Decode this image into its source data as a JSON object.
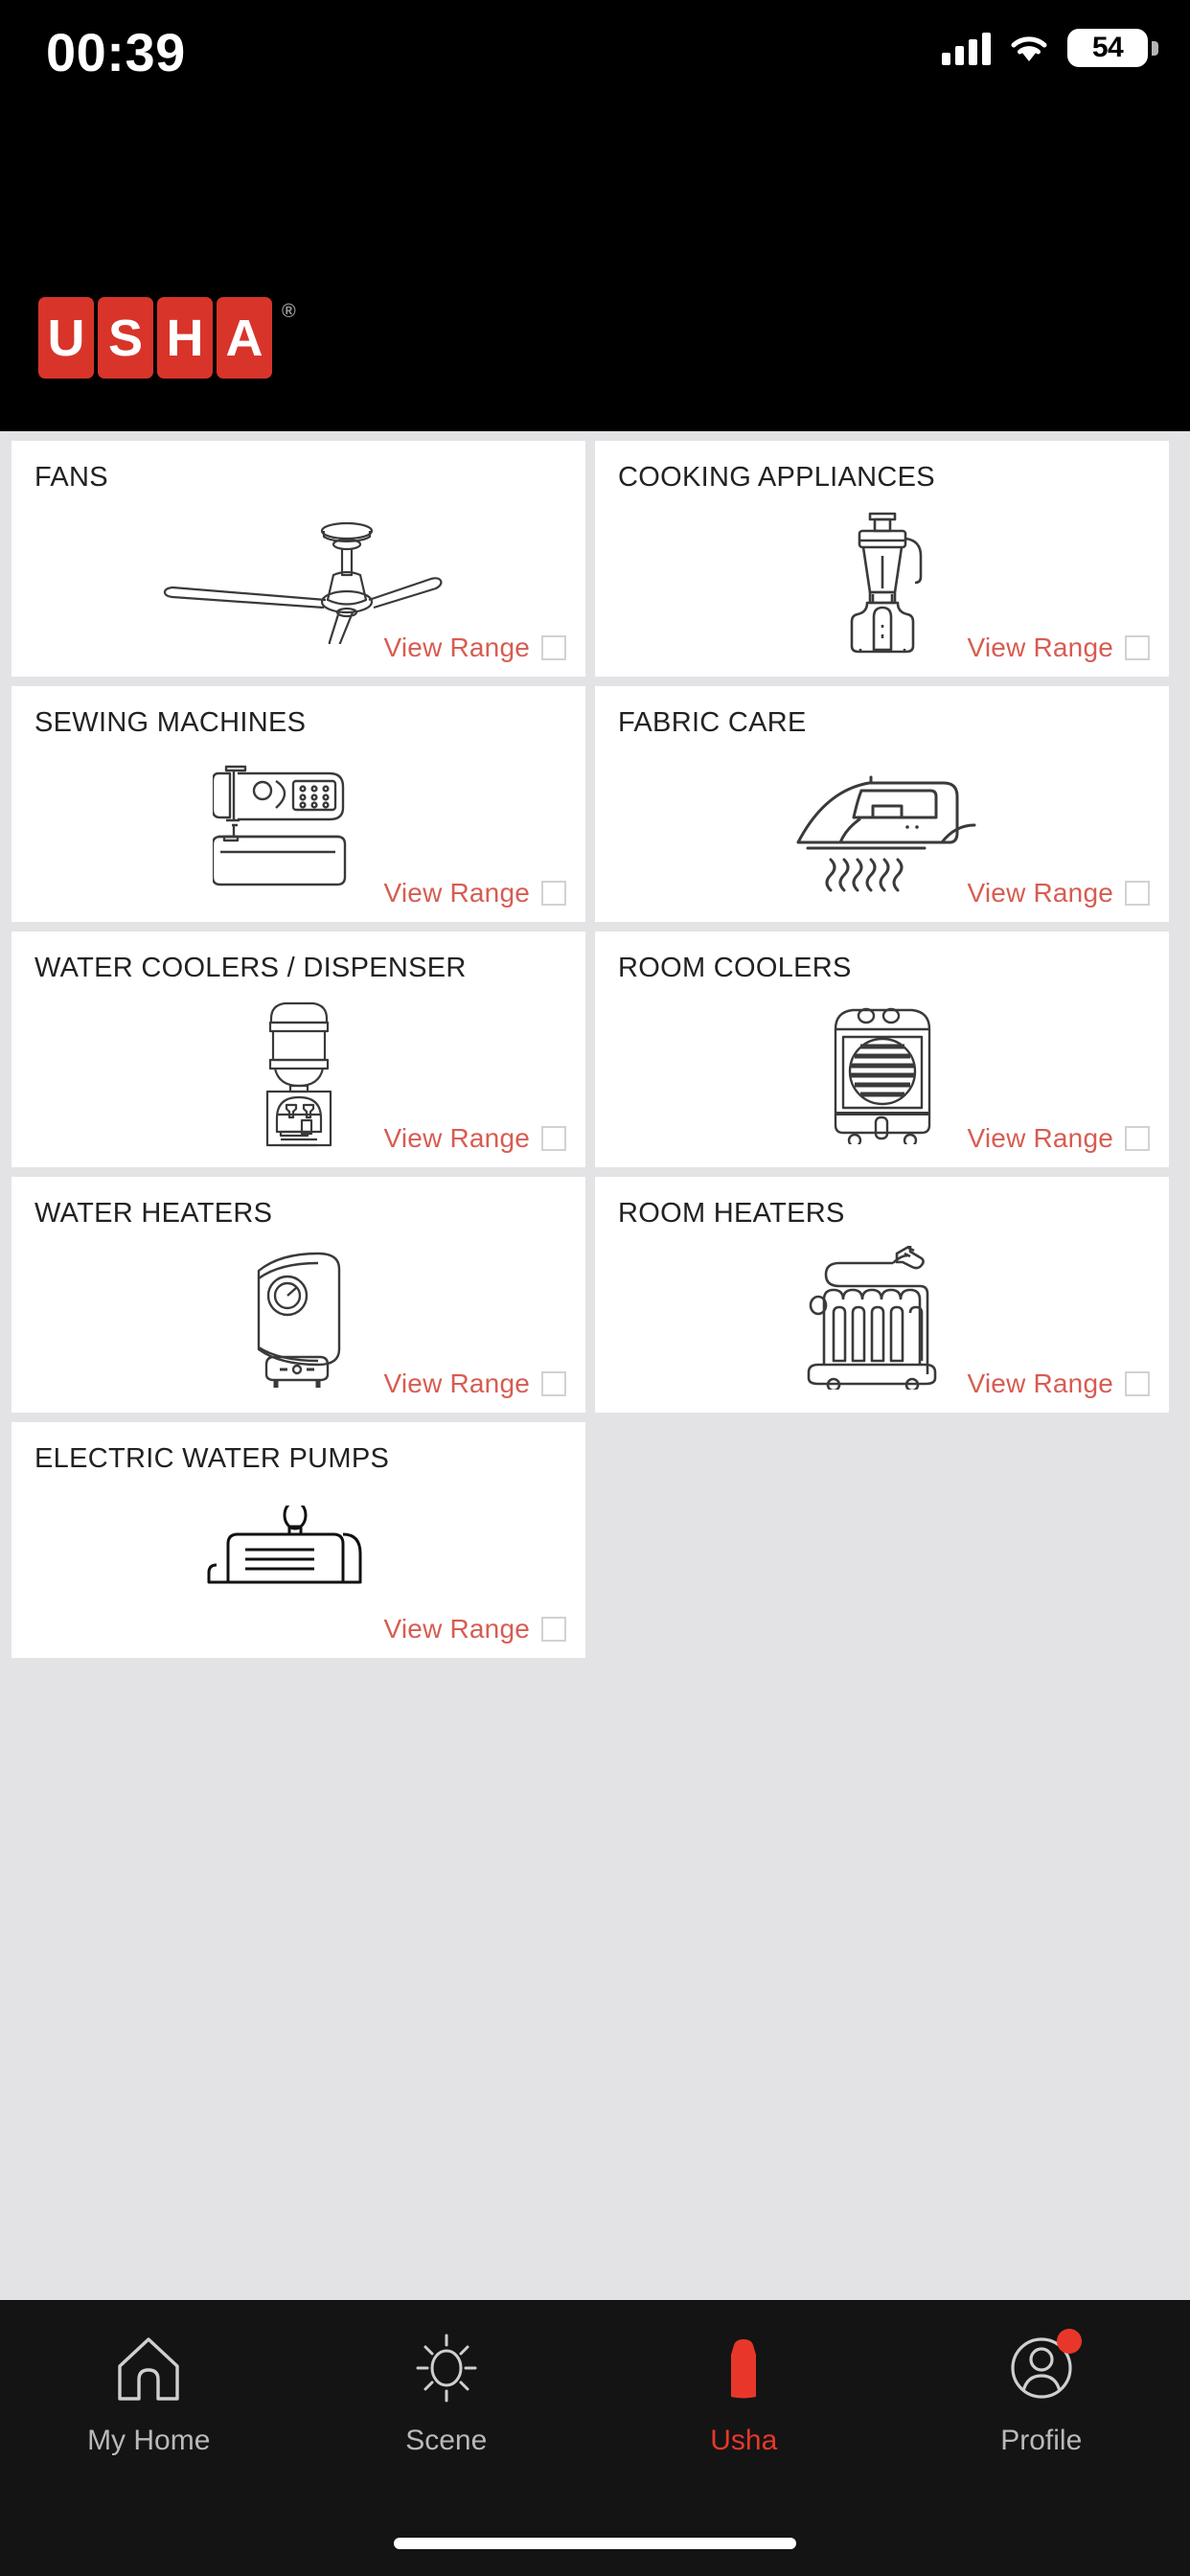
{
  "status_bar": {
    "time": "00:39",
    "battery_percent": "54",
    "icons": [
      "cellular-signal-icon",
      "wifi-icon",
      "battery-icon"
    ]
  },
  "header": {
    "brand": "USHA",
    "brand_letters": [
      "U",
      "S",
      "H",
      "A"
    ],
    "registered_mark": "®",
    "brand_color": "#d8342a",
    "background_color": "#000000"
  },
  "grid": {
    "view_range_label": "View Range",
    "cards": [
      {
        "title": "FANS",
        "icon": "ceiling-fan-icon"
      },
      {
        "title": "COOKING APPLIANCES",
        "icon": "blender-icon"
      },
      {
        "title": "SEWING MACHINES",
        "icon": "sewing-machine-icon"
      },
      {
        "title": "FABRIC CARE",
        "icon": "steam-iron-icon"
      },
      {
        "title": "WATER COOLERS / DISPENSER",
        "icon": "water-dispenser-icon"
      },
      {
        "title": "ROOM COOLERS",
        "icon": "room-cooler-icon"
      },
      {
        "title": "WATER HEATERS",
        "icon": "water-heater-icon"
      },
      {
        "title": "ROOM HEATERS",
        "icon": "oil-radiator-heater-icon"
      },
      {
        "title": "ELECTRIC WATER PUMPS",
        "icon": "water-pump-icon"
      }
    ]
  },
  "tab_bar": {
    "active": "Usha",
    "active_color": "#e8372a",
    "inactive_color": "#b9b9b9",
    "items": [
      {
        "label": "My Home",
        "icon": "home-icon",
        "active": false,
        "badge": false
      },
      {
        "label": "Scene",
        "icon": "sun-icon",
        "active": false,
        "badge": false
      },
      {
        "label": "Usha",
        "icon": "usha-shirt-icon",
        "active": true,
        "badge": false
      },
      {
        "label": "Profile",
        "icon": "user-circle-icon",
        "active": false,
        "badge": true
      }
    ]
  }
}
